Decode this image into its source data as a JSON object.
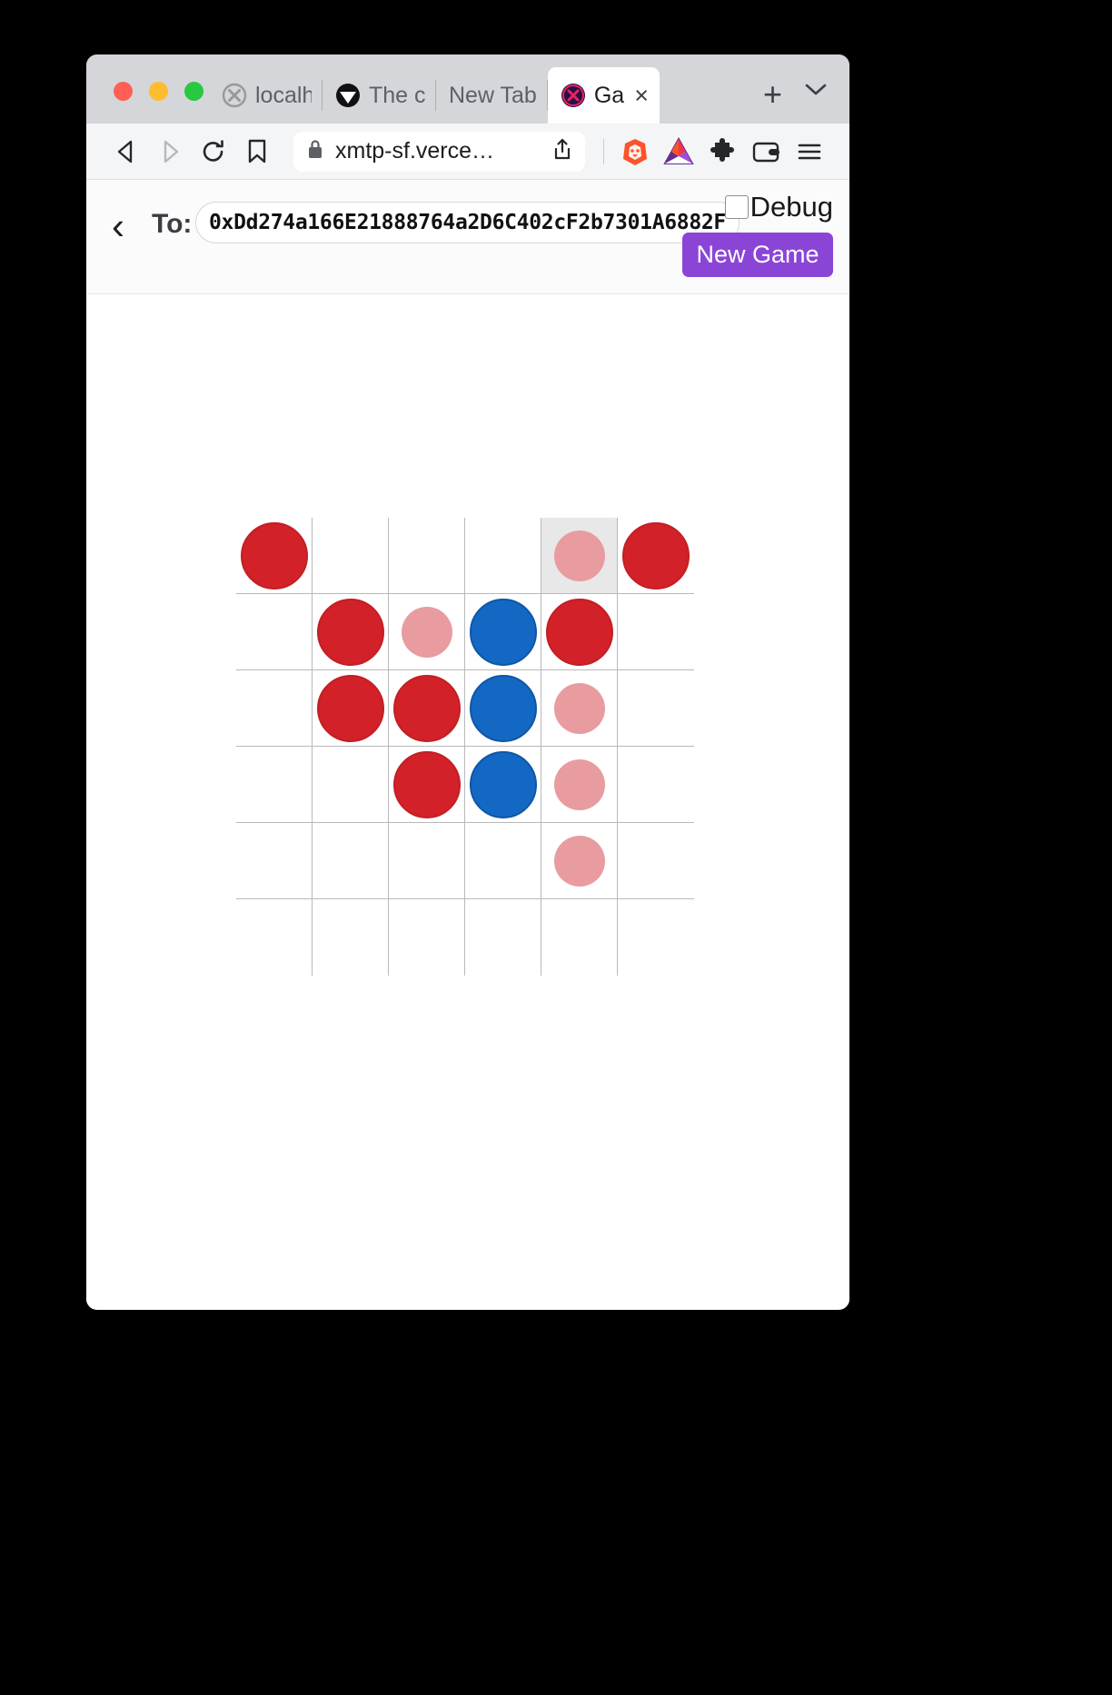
{
  "browser": {
    "traffic_lights": [
      "close",
      "minimize",
      "maximize"
    ],
    "tabs": [
      {
        "title": "localho",
        "favicon": "xmtp-grey-icon",
        "active": false
      },
      {
        "title": "The co",
        "favicon": "black-circle-icon",
        "active": false
      },
      {
        "title": "New Tab",
        "favicon": "none",
        "active": false
      },
      {
        "title": "Ga",
        "favicon": "xmtp-purple-icon",
        "active": true,
        "close_label": "×"
      }
    ],
    "new_tab_label": "+",
    "tab_menu_icon": "chevron-down-icon",
    "nav": {
      "back_icon": "back-triangle-icon",
      "forward_icon": "forward-triangle-icon",
      "reload_icon": "reload-icon",
      "bookmark_icon": "bookmark-icon"
    },
    "omnibox": {
      "lock_icon": "lock-icon",
      "url": "xmtp-sf.verce…",
      "share_icon": "share-icon"
    },
    "toolbar_right": {
      "brave_icon": "brave-lion-icon",
      "bat_icon": "bat-triangle-icon",
      "extensions_icon": "puzzle-piece-icon",
      "wallet_icon": "wallet-icon",
      "menu_icon": "hamburger-menu-icon"
    }
  },
  "app": {
    "back_chevron": "‹",
    "to_label": "To:",
    "address": "0xDd274a166E21888764a2D6C402cF2b7301A6882F",
    "debug_label": "Debug",
    "debug_checked": false,
    "new_game_label": "New Game"
  },
  "game": {
    "columns": 6,
    "rows": 6,
    "highlight_cell": {
      "row": 0,
      "col": 4
    },
    "legend": {
      "red": "#d22128",
      "blue": "#1368c4",
      "ghost": "#e89ca0",
      "highlight": "#e8e8e8",
      "grid_line": "#b9b9b9"
    },
    "grid": [
      [
        "red",
        "",
        "",
        "",
        "ghost",
        "red"
      ],
      [
        "",
        "red",
        "ghost",
        "blue",
        "red",
        ""
      ],
      [
        "",
        "red",
        "red",
        "blue",
        "ghost",
        ""
      ],
      [
        "",
        "",
        "red",
        "blue",
        "ghost",
        ""
      ],
      [
        "",
        "",
        "",
        "",
        "ghost",
        ""
      ],
      [
        "",
        "",
        "",
        "",
        "",
        ""
      ]
    ]
  }
}
